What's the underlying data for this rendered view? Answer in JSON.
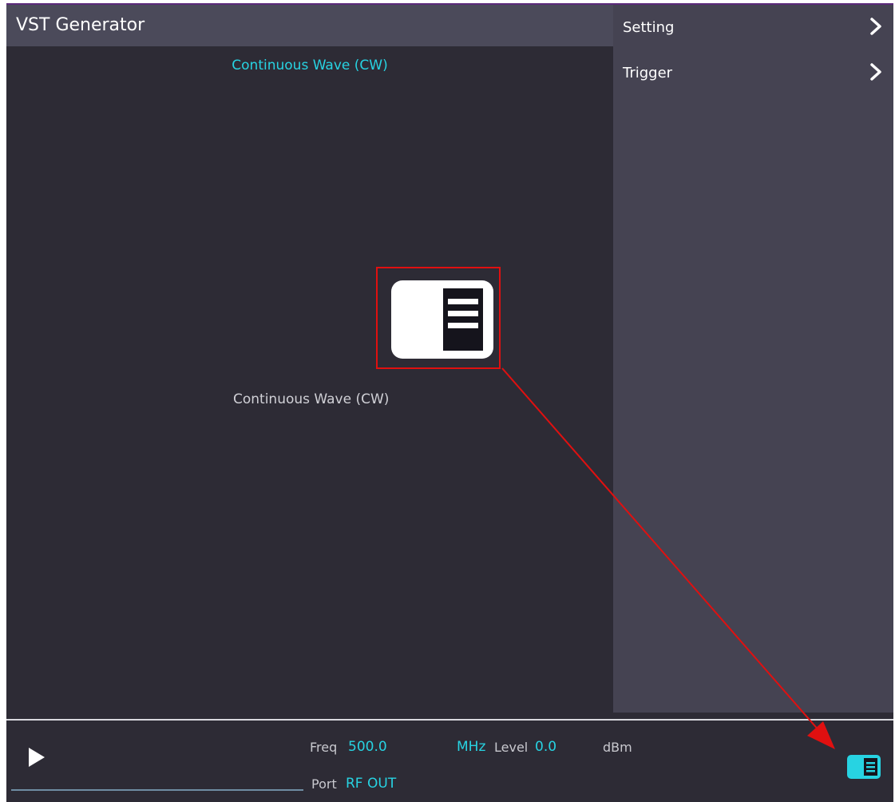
{
  "app": {
    "title": "VST Generator"
  },
  "side_menu": {
    "items": [
      {
        "label": "Setting",
        "icon": "chevron-right-icon"
      },
      {
        "label": "Trigger",
        "icon": "chevron-right-icon"
      }
    ]
  },
  "main": {
    "mode_title": "Continuous Wave (CW)",
    "mode_tile": {
      "caption": "Continuous Wave (CW)",
      "icon": "side-panel-icon"
    }
  },
  "status_bar": {
    "freq_label": "Freq",
    "freq_value": "500.0",
    "freq_unit": "MHz",
    "level_label": "Level",
    "level_value": "0.0",
    "level_unit": "dBm",
    "port_label": "Port",
    "port_value": "RF OUT",
    "play_icon": "play-icon",
    "panel_toggle_icon": "side-panel-icon"
  },
  "colors": {
    "accent": "#27d3e2",
    "background": "#2d2b35",
    "panel": "#454352",
    "annotation": "#e01010"
  }
}
